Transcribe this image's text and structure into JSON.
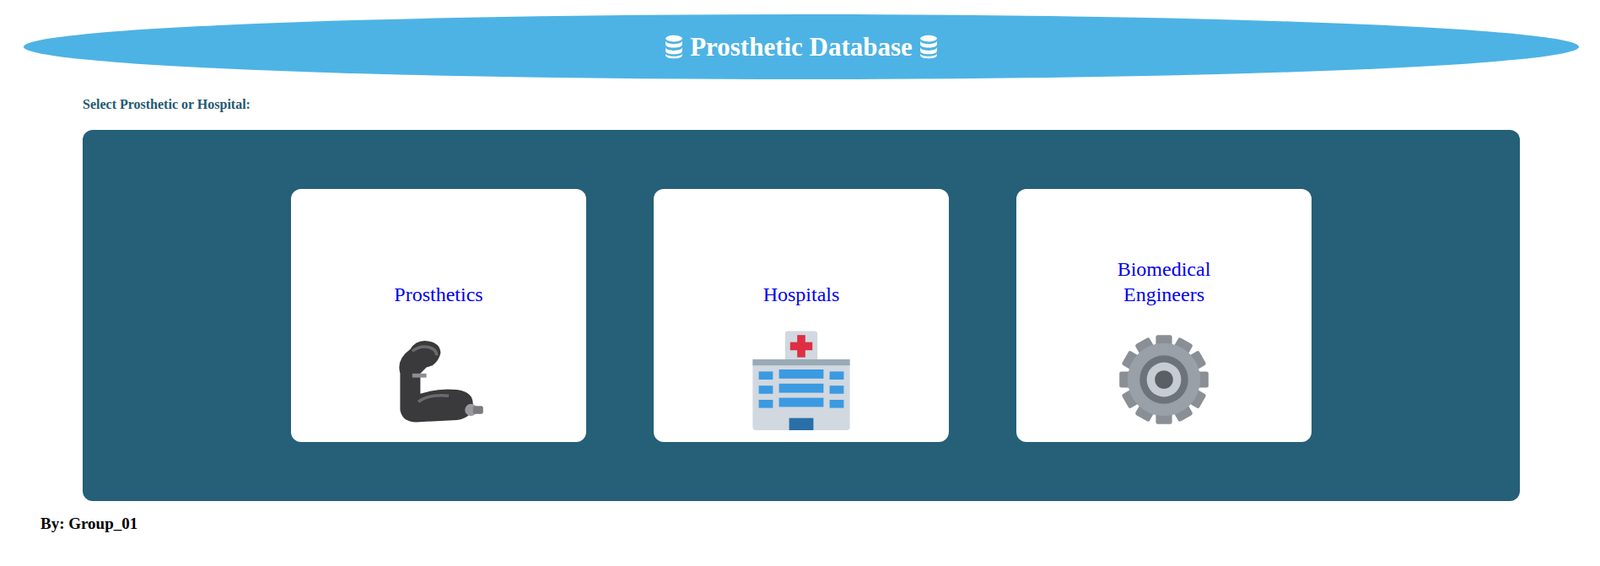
{
  "header": {
    "title": "Prosthetic Database"
  },
  "prompt": "Select Prosthetic or Hospital:",
  "cards": [
    {
      "label": "Prosthetics",
      "kind": "prosthetic"
    },
    {
      "label": "Hospitals",
      "kind": "hospital"
    },
    {
      "label": "Biomedical Engineers",
      "kind": "engineer"
    }
  ],
  "footer": "By: Group_01"
}
